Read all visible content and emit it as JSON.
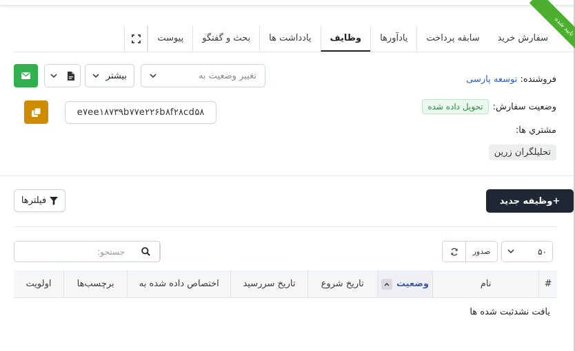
{
  "ribbon": "تایید شده",
  "tabs": [
    {
      "label": "سفارش خرید",
      "active": false
    },
    {
      "label": "سابقه پرداخت",
      "active": false
    },
    {
      "label": "يادآورها",
      "active": false
    },
    {
      "label": "وظايف",
      "active": true
    },
    {
      "label": "يادداشت ها",
      "active": false
    },
    {
      "label": "بحث و گفتگو",
      "active": false
    },
    {
      "label": "پیوست",
      "active": false
    }
  ],
  "order": {
    "seller_label": "فروشنده:",
    "seller_value": "توسعه پارسی",
    "status_label": "وضعيت سفارش:",
    "status_value": "تحويل داده شده",
    "customers_label": "مشتري ها:",
    "customer_value": "تحلیلگران زرین",
    "hash": "e۷ee۱۸۷۳۹b۷۷e۲۲۶b۸f۲۸cd۵۸"
  },
  "toolbar": {
    "change_status_placeholder": "تغيير وضعيت به",
    "more_label": "بیشتر"
  },
  "tasks": {
    "new_task_label": "+وظيفه جديد",
    "filters_label": "فيلترها",
    "search_placeholder": "جستجو:",
    "export_label": "صدور",
    "page_size": "۵۰",
    "columns": [
      "#",
      "نام",
      "وضعيت",
      "تاريخ شروع",
      "تاريخ سررسيد",
      "اختصاص داده شده به",
      "برچسب‌ها",
      "اولويت"
    ],
    "empty_message": "یافت نشدثبت شده ها"
  },
  "colors": {
    "ribbon": "#4caf30",
    "mail_button": "#33b04e",
    "copy_button": "#cf8c00",
    "new_task_button": "#1e2733",
    "link": "#2b63c6"
  }
}
